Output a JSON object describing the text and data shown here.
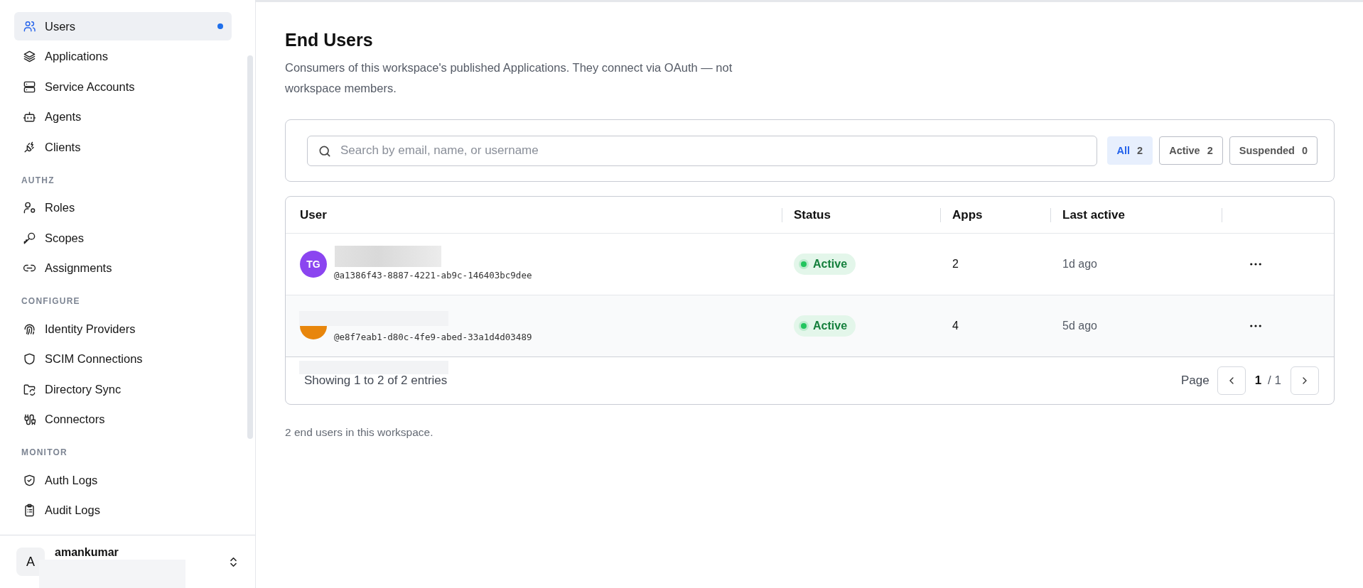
{
  "sidebar": {
    "sections": [
      {
        "items": [
          {
            "label": "Users",
            "selected": true,
            "indicator": true
          },
          {
            "label": "Applications",
            "selected": false,
            "indicator": false
          },
          {
            "label": "Service Accounts",
            "selected": false,
            "indicator": false
          },
          {
            "label": "Agents",
            "selected": false,
            "indicator": false
          },
          {
            "label": "Clients",
            "selected": false,
            "indicator": false
          }
        ]
      },
      {
        "title": "AUTHZ",
        "items": [
          {
            "label": "Roles",
            "selected": false,
            "indicator": false
          },
          {
            "label": "Scopes",
            "selected": false,
            "indicator": false
          },
          {
            "label": "Assignments",
            "selected": false,
            "indicator": false
          }
        ]
      },
      {
        "title": "CONFIGURE",
        "items": [
          {
            "label": "Identity Providers",
            "selected": false,
            "indicator": false
          },
          {
            "label": "SCIM Connections",
            "selected": false,
            "indicator": false
          },
          {
            "label": "Directory Sync",
            "selected": false,
            "indicator": false
          },
          {
            "label": "Connectors",
            "selected": false,
            "indicator": false
          }
        ]
      },
      {
        "title": "MONITOR",
        "items": [
          {
            "label": "Auth Logs",
            "selected": false,
            "indicator": false
          },
          {
            "label": "Audit Logs",
            "selected": false,
            "indicator": false
          }
        ]
      }
    ],
    "account": {
      "avatar": "A",
      "name": "amankumar"
    }
  },
  "page": {
    "title": "End Users",
    "description": "Consumers of this workspace's published Applications. They connect via OAuth — not workspace members."
  },
  "search": {
    "placeholder": "Search by email, name, or username"
  },
  "filters": [
    {
      "label": "All",
      "count": "2",
      "selected": true
    },
    {
      "label": "Active",
      "count": "2",
      "selected": false
    },
    {
      "label": "Suspended",
      "count": "0",
      "selected": false
    }
  ],
  "table": {
    "columns": [
      "User",
      "Status",
      "Apps",
      "Last active"
    ],
    "rows": [
      {
        "initials": "TG",
        "color": "#8b45f0",
        "username": "@a1386f43-8887-4221-ab9c-146403bc9dee",
        "status": "Active",
        "suspended": false,
        "apps": "2",
        "last_active": "1d ago",
        "highlighted": false
      },
      {
        "color": "#e8860c",
        "username": "@e8f7eab1-d80c-4fe9-abed-33a1d4d03489",
        "status": "Active",
        "suspended": false,
        "apps": "4",
        "last_active": "5d ago",
        "highlighted": true
      }
    ],
    "footer": {
      "summary": "Showing 1 to 2 of 2 entries",
      "page_label": "Page",
      "current": "1",
      "total": "/ 1"
    }
  },
  "note": "2 end users in this workspace."
}
